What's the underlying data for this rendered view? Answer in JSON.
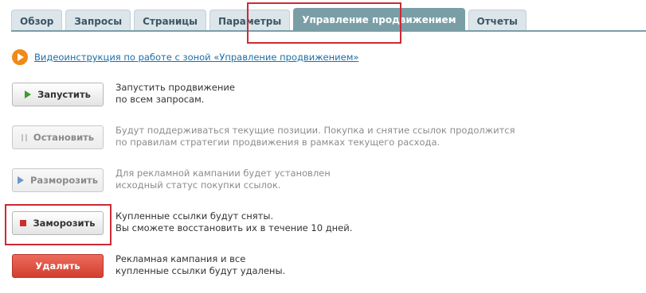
{
  "tabs": [
    {
      "label": "Обзор",
      "active": false
    },
    {
      "label": "Запросы",
      "active": false
    },
    {
      "label": "Страницы",
      "active": false
    },
    {
      "label": "Параметры",
      "active": false
    },
    {
      "label": "Управление продвижением",
      "active": true
    },
    {
      "label": "Отчеты",
      "active": false
    }
  ],
  "video": {
    "icon": "play-circle-icon",
    "link_text": "Видеоинструкция по работе с зоной «Управление продвижением»"
  },
  "actions": {
    "start": {
      "label": "Запустить",
      "icon": "play-icon",
      "desc_line1": "Запустить продвижение",
      "desc_line2": "по всем запросам."
    },
    "stop": {
      "label": "Остановить",
      "icon": "pause-icon",
      "desc_line1": "Будут поддерживаться текущие позиции. Покупка и снятие ссылок продолжится",
      "desc_line2": "по правилам стратегии продвижения в рамках текущего расхода."
    },
    "unfreeze": {
      "label": "Разморозить",
      "icon": "play-icon",
      "desc_line1": "Для рекламной кампании будет установлен",
      "desc_line2": "исходный статус покупки ссылок."
    },
    "freeze": {
      "label": "Заморозить",
      "icon": "stop-icon",
      "desc_line1": "Купленные ссылки будут сняты.",
      "desc_line2": "Вы сможете восстановить их в течение 10 дней."
    },
    "delete": {
      "label": "Удалить",
      "desc_line1": "Рекламная кампания и все",
      "desc_line2": "купленные ссылки будут удалены."
    }
  },
  "colors": {
    "accent_tab": "#7a9ea6",
    "highlight": "#cc2a35",
    "danger": "#d23f30",
    "link": "#1a6fa8"
  }
}
